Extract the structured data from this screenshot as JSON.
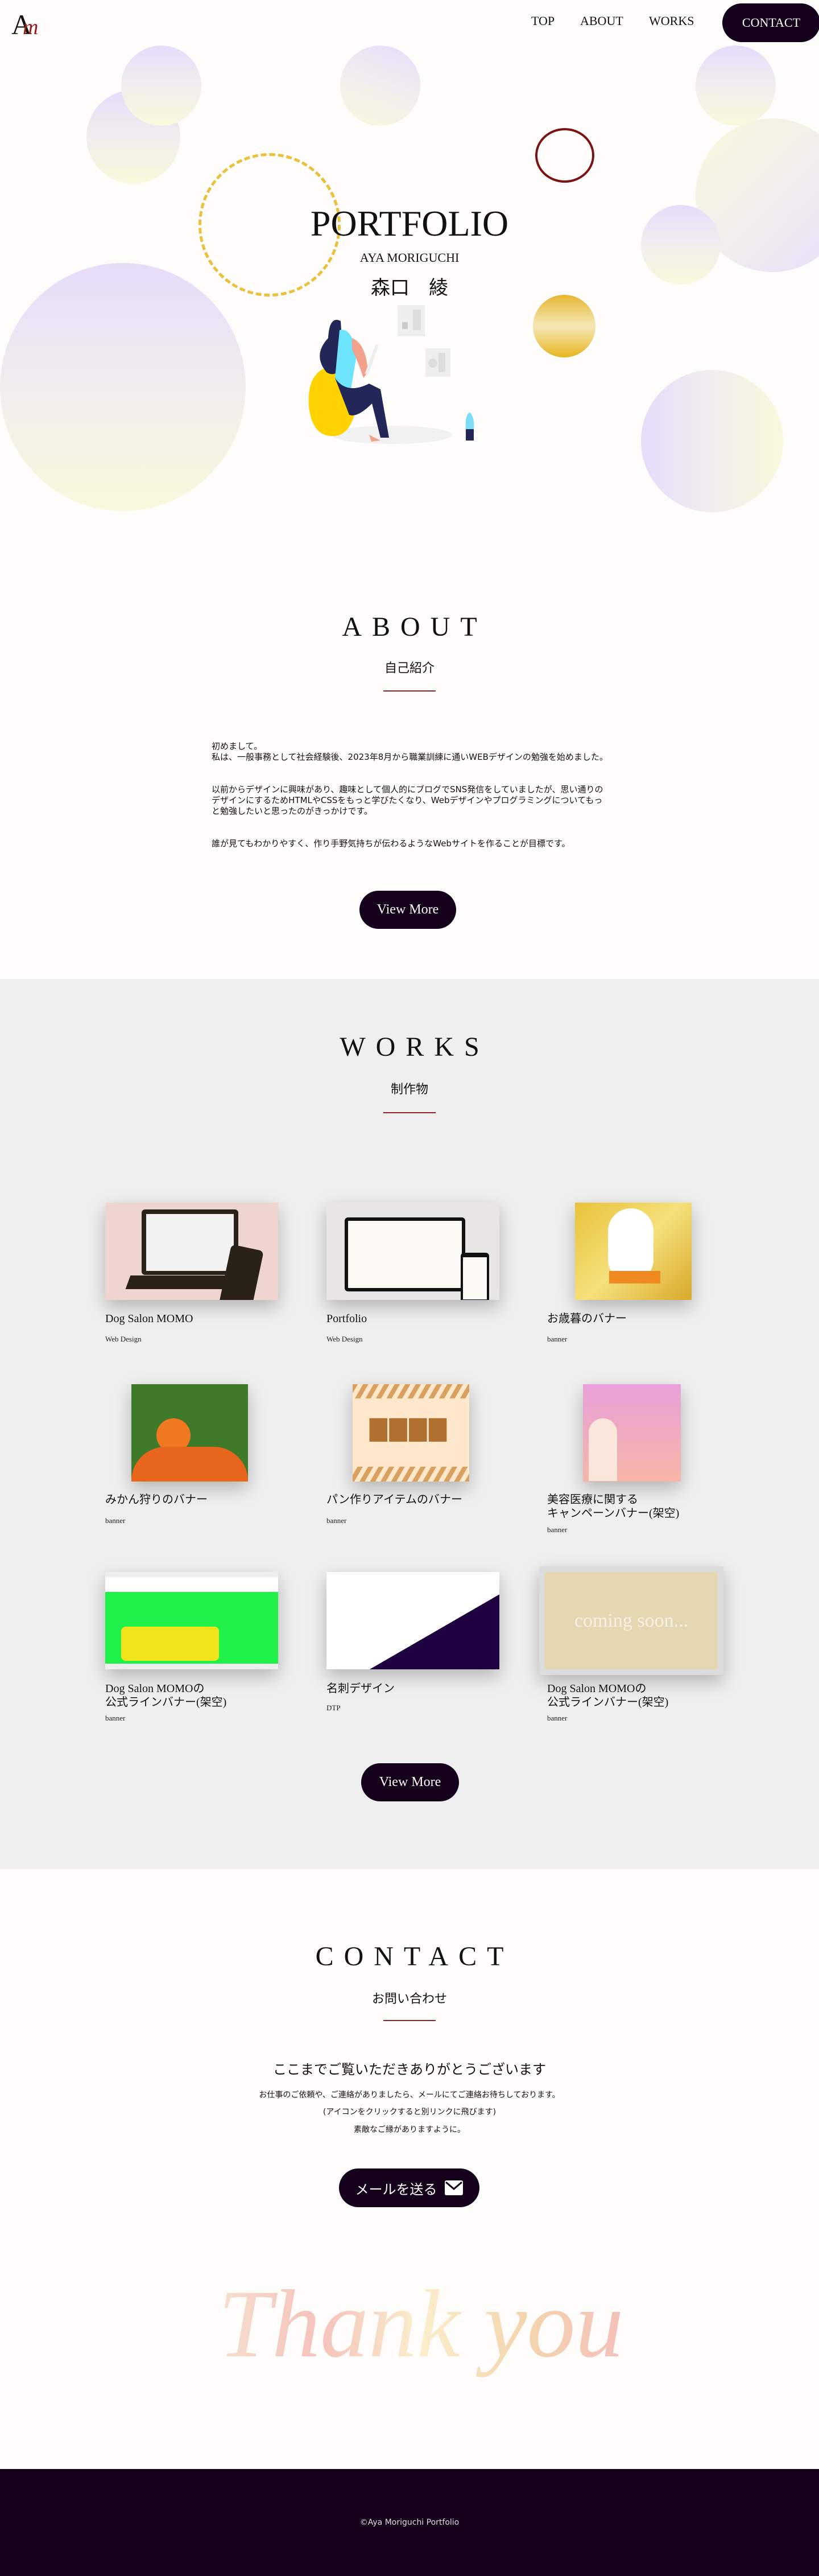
{
  "colors": {
    "accent": "#14001a",
    "line": "#8a2323",
    "works_bg": "#efefef",
    "page_bg": "#fffdfb"
  },
  "header": {
    "logo": "AM",
    "nav": [
      "TOP",
      "ABOUT",
      "WORKS"
    ],
    "contact_label": "CONTACT"
  },
  "hero": {
    "title": "PORTFOLIO",
    "name_en": "AYA MORIGUCHI",
    "name_ja": "森口　綾"
  },
  "about": {
    "title": "ABOUT",
    "subtitle": "自己紹介",
    "paragraphs": [
      "初めまして。\n私は、一般事務として社会経験後、2023年8月から職業訓練に通いWEBデザインの勉強を始めました。",
      "以前からデザインに興味があり、趣味として個人的にブログでSNS発信をしていましたが、思い通りのデザインにするためHTMLやCSSをもっと学びたくなり、Webデザインやプログラミングについてもっと勉強したいと思ったのがきっかけです。",
      "誰が見てもわかりやすく、作り手野気持ちが伝わるようなWebサイトを作ることが目標です。"
    ],
    "button": "View More"
  },
  "works": {
    "title": "WORKS",
    "subtitle": "制作物",
    "button": "View More",
    "items": [
      {
        "title": "Dog Salon MOMO",
        "category": "Web Design"
      },
      {
        "title": "Portfolio",
        "category": "Web Design"
      },
      {
        "title": "お歳暮のバナー",
        "category": "banner"
      },
      {
        "title": "みかん狩りのバナー",
        "category": "banner"
      },
      {
        "title": "パン作りアイテムのバナー",
        "category": "banner"
      },
      {
        "title": "美容医療に関する\nキャンペーンバナー(架空)",
        "category": "banner"
      },
      {
        "title": "Dog Salon MOMOの\n公式ラインバナー(架空)",
        "category": "banner"
      },
      {
        "title": "名刺デザイン",
        "category": "DTP"
      },
      {
        "title": "Dog Salon MOMOの\n公式ラインバナー(架空)",
        "category": "banner",
        "placeholder": "coming soon..."
      }
    ]
  },
  "contact": {
    "title": "CONTACT",
    "subtitle": "お問い合わせ",
    "thanks": "ここまでご覧いただきありがとうございます",
    "lines": [
      "お仕事のご依頼や、ご連絡がありましたら、メールにてご連絡お待ちしております。",
      "(アイコンをクリックすると別リンクに飛びます)",
      "素敵なご縁がありますように。"
    ],
    "button": "メールを送る",
    "button_icon": "mail-icon"
  },
  "thankyou": "Thank you",
  "footer": {
    "copyright": "©Aya Moriguchi Portfolio"
  }
}
